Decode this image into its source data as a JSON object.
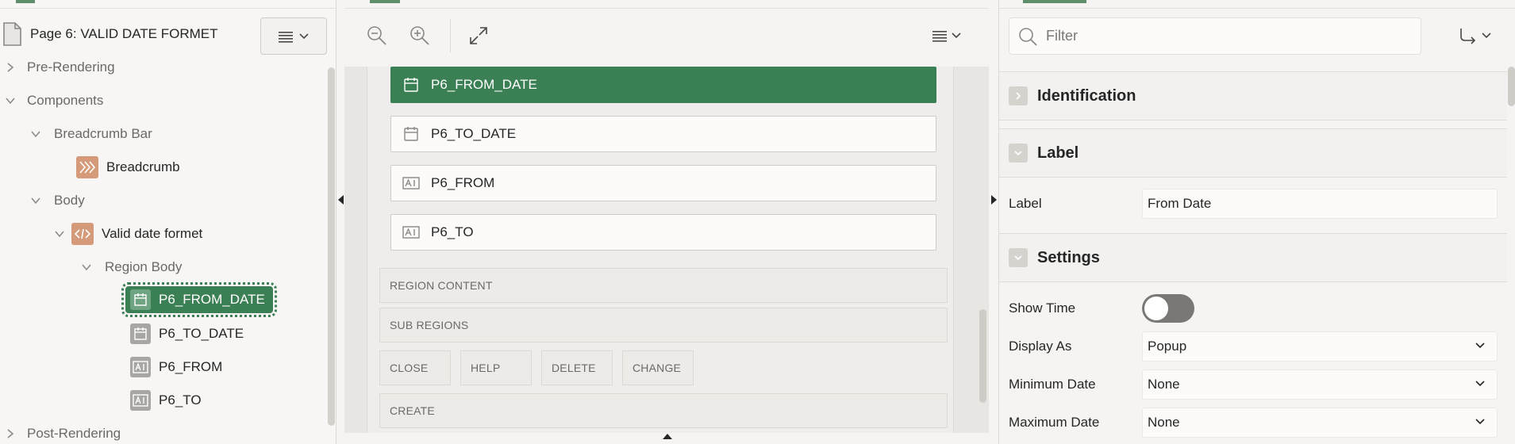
{
  "page_designer": {
    "page_title": "Page 6: VALID DATE FORMET"
  },
  "tree": {
    "nodes": [
      {
        "label": "Pre-Rendering"
      },
      {
        "label": "Components"
      },
      {
        "label": "Breadcrumb Bar"
      },
      {
        "label": "Breadcrumb"
      },
      {
        "label": "Body"
      },
      {
        "label": "Valid date formet"
      },
      {
        "label": "Region Body"
      },
      {
        "label": "P6_FROM_DATE"
      },
      {
        "label": "P6_TO_DATE"
      },
      {
        "label": "P6_FROM"
      },
      {
        "label": "P6_TO"
      },
      {
        "label": "Post-Rendering"
      }
    ]
  },
  "layout": {
    "fields": [
      {
        "label": "P6_FROM_DATE",
        "icon": "calendar-icon"
      },
      {
        "label": "P6_TO_DATE",
        "icon": "calendar-icon"
      },
      {
        "label": "P6_FROM",
        "icon": "text-field-icon"
      },
      {
        "label": "P6_TO",
        "icon": "text-field-icon"
      }
    ],
    "slots": {
      "region_content": "REGION CONTENT",
      "sub_regions": "SUB REGIONS",
      "close": "CLOSE",
      "help": "HELP",
      "delete": "DELETE",
      "change": "CHANGE",
      "create": "CREATE"
    }
  },
  "properties": {
    "filter_placeholder": "Filter",
    "sections": {
      "identification": "Identification",
      "label": "Label",
      "settings": "Settings"
    },
    "rows": {
      "label_name": "Label",
      "label_value": "From Date",
      "show_time_name": "Show Time",
      "show_time_on": false,
      "display_as_name": "Display As",
      "display_as_value": "Popup",
      "min_date_name": "Minimum Date",
      "min_date_value": "None",
      "max_date_name": "Maximum Date",
      "max_date_value": "None"
    }
  },
  "colors": {
    "accent": "#3b7f55",
    "orange_icon": "#d49a7a",
    "gray_icon": "#a8a6a3"
  }
}
